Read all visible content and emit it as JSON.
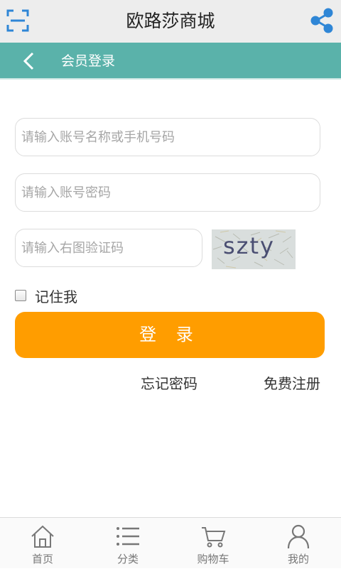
{
  "header": {
    "title": "欧路莎商城",
    "scan_icon": "scan-icon",
    "share_icon": "share-icon",
    "accent": "#2f86d6"
  },
  "subheader": {
    "back_icon": "chevron-left-icon",
    "title": "会员登录",
    "background": "#5ab2aa"
  },
  "form": {
    "account_placeholder": "请输入账号名称或手机号码",
    "password_placeholder": "请输入账号密码",
    "captcha_placeholder": "请输入右图验证码",
    "captcha_text": "szty",
    "remember_label": "记住我",
    "login_label": "登 录",
    "login_color": "#ff9d00",
    "forgot_label": "忘记密码",
    "register_label": "免费注册"
  },
  "tabbar": {
    "items": [
      {
        "label": "首页",
        "icon": "home-icon"
      },
      {
        "label": "分类",
        "icon": "list-icon"
      },
      {
        "label": "购物车",
        "icon": "cart-icon"
      },
      {
        "label": "我的",
        "icon": "user-icon"
      }
    ]
  }
}
